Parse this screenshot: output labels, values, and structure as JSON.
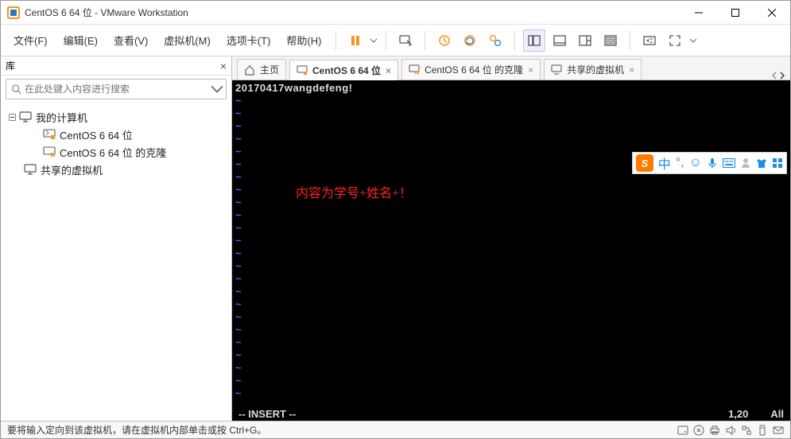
{
  "title": "CentOS 6 64 位 - VMware Workstation",
  "menu": {
    "file": "文件(F)",
    "edit": "编辑(E)",
    "view": "查看(V)",
    "vm": "虚拟机(M)",
    "tabs": "选项卡(T)",
    "help": "帮助(H)"
  },
  "sidebar": {
    "title": "库",
    "search_placeholder": "在此处键入内容进行搜索",
    "root": "我的计算机",
    "item1": "CentOS 6 64 位",
    "item2": "CentOS 6 64 位 的克隆",
    "shared": "共享的虚拟机"
  },
  "tabs_data": {
    "home": "主页",
    "t1": "CentOS 6 64 位",
    "t2": "CentOS 6 64 位 的克隆",
    "t3": "共享的虚拟机"
  },
  "terminal": {
    "line1": "20170417wangdefeng!",
    "annotation": "内容为学号+姓名+！",
    "mode": "-- INSERT --",
    "pos": "1,20",
    "all": "All",
    "tilde": "~",
    "ime_zh": "中"
  },
  "statusbar": {
    "msg": "要将输入定向到该虚拟机，请在虚拟机内部单击或按 Ctrl+G。"
  }
}
